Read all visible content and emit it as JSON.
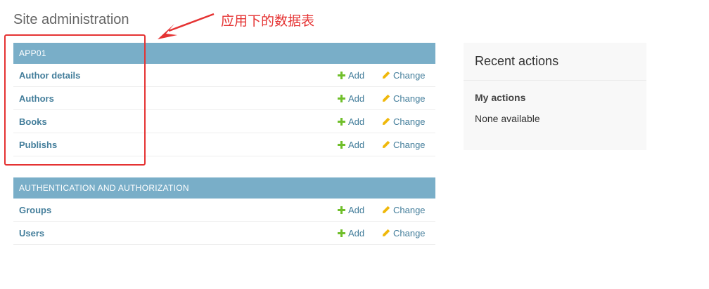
{
  "page": {
    "title": "Site administration"
  },
  "modules": [
    {
      "caption": "APP01",
      "rows": [
        {
          "name": "Author details",
          "add": "Add",
          "change": "Change"
        },
        {
          "name": "Authors",
          "add": "Add",
          "change": "Change"
        },
        {
          "name": "Books",
          "add": "Add",
          "change": "Change"
        },
        {
          "name": "Publishs",
          "add": "Add",
          "change": "Change"
        }
      ]
    },
    {
      "caption": "AUTHENTICATION AND AUTHORIZATION",
      "rows": [
        {
          "name": "Groups",
          "add": "Add",
          "change": "Change"
        },
        {
          "name": "Users",
          "add": "Add",
          "change": "Change"
        }
      ]
    }
  ],
  "recent_actions": {
    "title": "Recent actions",
    "subtitle": "My actions",
    "empty_text": "None available"
  },
  "annotation": {
    "text": "应用下的数据表",
    "color": "#e53333"
  },
  "colors": {
    "header": "#79aec8",
    "link": "#447e9b",
    "add_icon": "#70bf2b",
    "change_icon": "#efb80b"
  }
}
